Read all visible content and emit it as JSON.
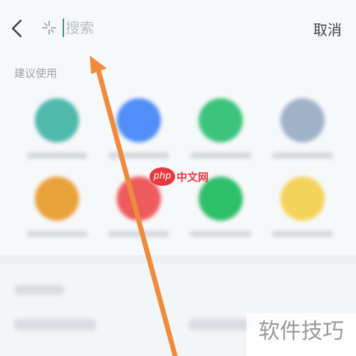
{
  "search": {
    "placeholder": "搜索",
    "cancel_label": "取消",
    "back_icon": "chevron-left-icon",
    "sparkle_icon": "sparkle-icon"
  },
  "suggested": {
    "title": "建议使用",
    "apps": [
      {
        "color": "#4fb9ad"
      },
      {
        "color": "#4f8ff7"
      },
      {
        "color": "#3cc47c"
      },
      {
        "color": "#9fb3c8"
      },
      {
        "color": "#e9a13b"
      },
      {
        "color": "#ef5b5b"
      },
      {
        "color": "#2fbf6a"
      },
      {
        "color": "#f5d35a"
      }
    ]
  },
  "watermarks": {
    "logo_php": "php",
    "logo_site": "中文网",
    "corner_text": "软件技巧"
  },
  "colors": {
    "arrow": "#f08a3c",
    "accent_caret": "#3f8f8a"
  }
}
